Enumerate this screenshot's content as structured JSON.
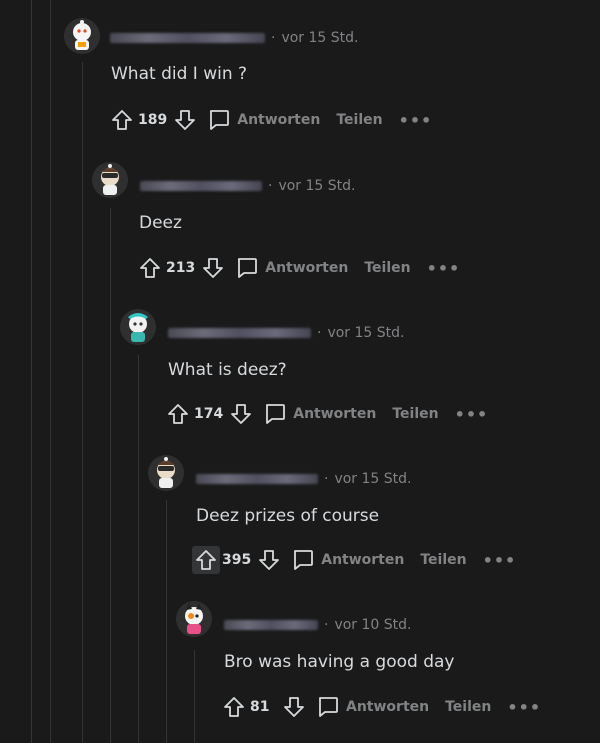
{
  "comments": [
    {
      "time": "vor 15 Std.",
      "text": "What did I win ?",
      "votes": "189"
    },
    {
      "time": "vor 15 Std.",
      "text": "Deez",
      "votes": "213"
    },
    {
      "time": "vor 15 Std.",
      "text": "What is deez?",
      "votes": "174"
    },
    {
      "time": "vor 15 Std.",
      "text": "Deez prizes of course",
      "votes": "395"
    },
    {
      "time": "vor 10 Std.",
      "text": "Bro was having a good day",
      "votes": "81"
    }
  ],
  "labels": {
    "reply": "Antworten",
    "share": "Teilen",
    "more": "•••",
    "sep": "·"
  },
  "colors": {
    "background": "#1a1a1b",
    "text": "#d7dadc",
    "muted": "#818384"
  }
}
